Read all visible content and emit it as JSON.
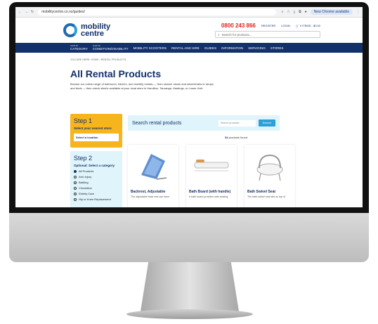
{
  "browser": {
    "url": "mobilitycentre.co.nz/guides/",
    "new_chrome_label": "New Chrome available"
  },
  "header": {
    "logo_line1": "mobility",
    "logo_line2": "centre",
    "phone": "0800 243 866",
    "register": "REGISTER",
    "login": "LOGIN",
    "cart": "0 ITEMS - $0.00",
    "search_placeholder": "Search for products..."
  },
  "nav": {
    "items": [
      {
        "sub": "SHOP BY",
        "label": "CATEGORY"
      },
      {
        "sub": "SHOP BY",
        "label": "CONDITION/DISABILITY"
      },
      {
        "label": "MOBILITY SCOOTERS"
      },
      {
        "label": "RENTAL AND HIRE"
      },
      {
        "label": "GUIDES"
      },
      {
        "label": "INFORMATION"
      },
      {
        "label": "SERVICING"
      },
      {
        "label": "STORES"
      }
    ]
  },
  "breadcrumb": "YOU ARE HERE: HOME / RENTAL PRODUCTS",
  "page": {
    "title": "All Rental Products",
    "intro": "Browse our online range of bathroom, kitchen, and mobility rentals — from shower stools and wheelchairs to ramps and beds — then check what's available at your local store in Hamilton, Tauranga, Hastings, or Lower Hutt."
  },
  "step1": {
    "title": "Step 1",
    "subtitle": "Select your nearest store",
    "button": "Select a location"
  },
  "step2": {
    "title": "Step 2",
    "subtitle": "Optional: Select a category",
    "categories": [
      "All Products",
      "Arm Injury",
      "Bathing",
      "Circulation",
      "Elderly Care",
      "Hip or Knee Replacement"
    ]
  },
  "search": {
    "label": "Search rental products",
    "placeholder": "Search products...",
    "button": "Search",
    "count": "34",
    "count_suffix": "products found"
  },
  "products": [
    {
      "name": "Backrest, Adjustable",
      "desc": "The adjustable back rest can have"
    },
    {
      "name": "Bath Board (with handle)",
      "desc": "A bath board provides safe seating"
    },
    {
      "name": "Bath Swivel Seat",
      "desc": "The bath swivel seat sits on top of"
    }
  ],
  "colors": {
    "navy": "#12306a",
    "accent": "#f6b51c",
    "light": "#dff4fb",
    "phone": "#e2231a"
  }
}
